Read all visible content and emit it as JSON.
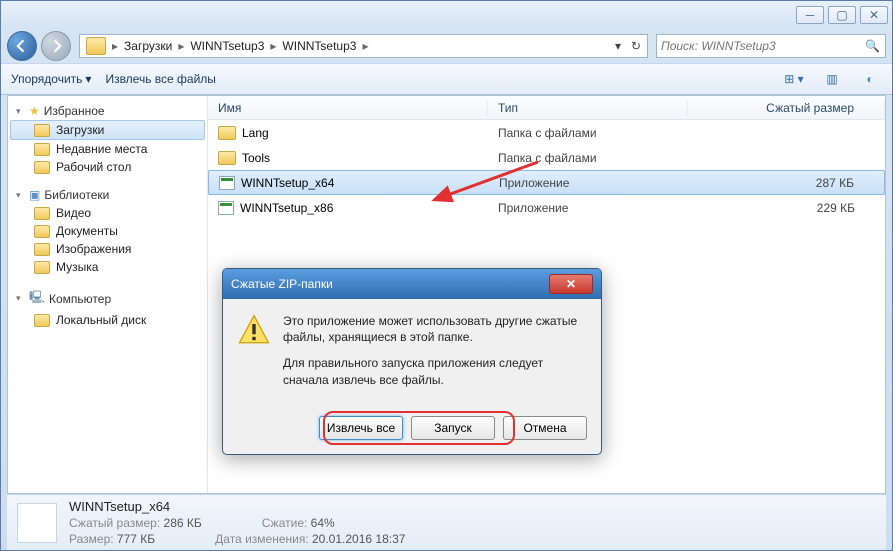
{
  "breadcrumbs": [
    "Загрузки",
    "WINNTsetup3",
    "WINNTsetup3"
  ],
  "search": {
    "placeholder": "Поиск: WINNTsetup3"
  },
  "toolbar": {
    "organize": "Упорядочить",
    "extract_all": "Извлечь все файлы"
  },
  "columns": {
    "name": "Имя",
    "type": "Тип",
    "csize": "Сжатый размер"
  },
  "sidebar": {
    "favorites": {
      "label": "Избранное",
      "items": [
        {
          "label": "Загрузки",
          "selected": true
        },
        {
          "label": "Недавние места"
        },
        {
          "label": "Рабочий стол"
        }
      ]
    },
    "libraries": {
      "label": "Библиотеки",
      "items": [
        {
          "label": "Видео"
        },
        {
          "label": "Документы"
        },
        {
          "label": "Изображения"
        },
        {
          "label": "Музыка"
        }
      ]
    },
    "computer": {
      "label": "Компьютер",
      "items": [
        {
          "label": "Локальный диск"
        }
      ]
    }
  },
  "files": [
    {
      "name": "Lang",
      "type": "Папка с файлами",
      "size": "",
      "kind": "folder"
    },
    {
      "name": "Tools",
      "type": "Папка с файлами",
      "size": "",
      "kind": "folder"
    },
    {
      "name": "WINNTsetup_x64",
      "type": "Приложение",
      "size": "287 КБ",
      "kind": "app",
      "selected": true
    },
    {
      "name": "WINNTsetup_x86",
      "type": "Приложение",
      "size": "229 КБ",
      "kind": "app"
    }
  ],
  "status": {
    "name": "WINNTsetup_x64",
    "csize_label": "Сжатый размер:",
    "csize": "286 КБ",
    "ratio_label": "Сжатие:",
    "ratio": "64%",
    "size_label": "Размер:",
    "size": "777 КБ",
    "date_label": "Дата изменения:",
    "date": "20.01.2016 18:37"
  },
  "dialog": {
    "title": "Сжатые ZIP-папки",
    "line1": "Это приложение может использовать другие сжатые файлы, хранящиеся в этой папке.",
    "line2": "Для правильного запуска приложения следует сначала извлечь все файлы.",
    "btn_extract": "Извлечь все",
    "btn_run": "Запуск",
    "btn_cancel": "Отмена"
  }
}
